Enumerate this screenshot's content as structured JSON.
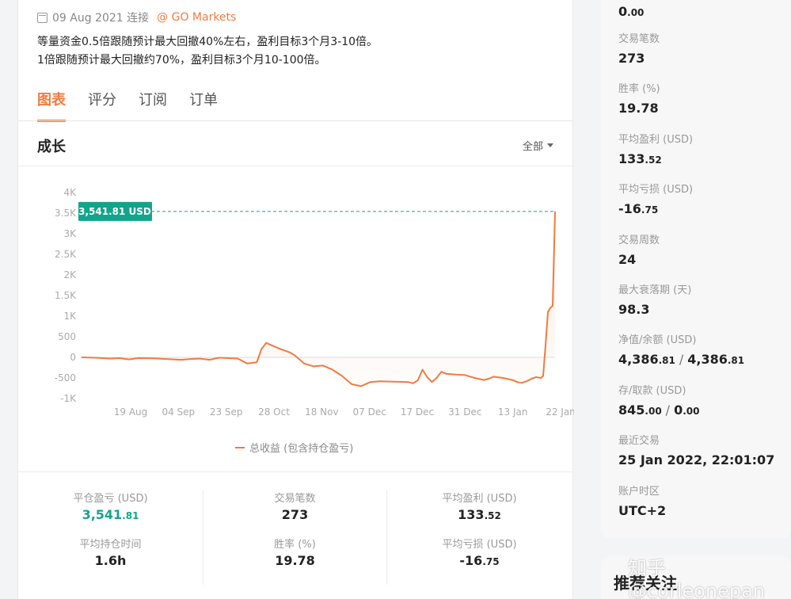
{
  "header": {
    "date": "09 Aug 2021 连接",
    "broker": "@ GO Markets",
    "description_line1": "等量资金0.5倍跟随预计最大回撤40%左右，盈利目标3个月3-10倍。",
    "description_line2": "1倍跟随预计最大回撤约70%，盈利目标3个月10-100倍。"
  },
  "tabs": [
    {
      "label": "图表",
      "active": true
    },
    {
      "label": "评分",
      "active": false
    },
    {
      "label": "订阅",
      "active": false
    },
    {
      "label": "订单",
      "active": false
    }
  ],
  "card": {
    "title": "成长",
    "filter_label": "全部"
  },
  "chart_data": {
    "type": "area",
    "y_ticks": [
      "4K",
      "3.5K",
      "3K",
      "2.5K",
      "2K",
      "1.5K",
      "1K",
      "500",
      "0",
      "-500",
      "-1K"
    ],
    "x_ticks": [
      "19 Aug",
      "04 Sep",
      "23 Sep",
      "28 Oct",
      "18 Nov",
      "07 Dec",
      "17 Dec",
      "31 Dec",
      "13 Jan",
      "22 Jan"
    ],
    "ylim": [
      -1000,
      4000
    ],
    "current_label": "3,541.81 USD",
    "current_value": 3541.81,
    "line_color": "#f07b3f",
    "label_color": "#12a58b",
    "series": [
      {
        "name": "总收益 (包含持仓盈亏)",
        "points": [
          [
            0,
            0
          ],
          [
            0.03,
            -10
          ],
          [
            0.06,
            -30
          ],
          [
            0.08,
            -20
          ],
          [
            0.1,
            -50
          ],
          [
            0.12,
            -20
          ],
          [
            0.15,
            -25
          ],
          [
            0.18,
            -40
          ],
          [
            0.21,
            -60
          ],
          [
            0.23,
            -40
          ],
          [
            0.25,
            -30
          ],
          [
            0.27,
            -60
          ],
          [
            0.29,
            -10
          ],
          [
            0.31,
            -20
          ],
          [
            0.33,
            -30
          ],
          [
            0.35,
            -150
          ],
          [
            0.37,
            -120
          ],
          [
            0.38,
            200
          ],
          [
            0.39,
            350
          ],
          [
            0.4,
            300
          ],
          [
            0.42,
            200
          ],
          [
            0.44,
            120
          ],
          [
            0.45,
            50
          ],
          [
            0.47,
            -150
          ],
          [
            0.49,
            -220
          ],
          [
            0.51,
            -200
          ],
          [
            0.53,
            -300
          ],
          [
            0.55,
            -450
          ],
          [
            0.57,
            -650
          ],
          [
            0.59,
            -700
          ],
          [
            0.6,
            -650
          ],
          [
            0.61,
            -600
          ],
          [
            0.63,
            -580
          ],
          [
            0.66,
            -590
          ],
          [
            0.69,
            -600
          ],
          [
            0.7,
            -630
          ],
          [
            0.71,
            -560
          ],
          [
            0.72,
            -300
          ],
          [
            0.73,
            -480
          ],
          [
            0.74,
            -600
          ],
          [
            0.75,
            -500
          ],
          [
            0.76,
            -350
          ],
          [
            0.77,
            -400
          ],
          [
            0.79,
            -420
          ],
          [
            0.81,
            -430
          ],
          [
            0.83,
            -500
          ],
          [
            0.85,
            -550
          ],
          [
            0.86,
            -520
          ],
          [
            0.87,
            -470
          ],
          [
            0.89,
            -500
          ],
          [
            0.91,
            -550
          ],
          [
            0.92,
            -600
          ],
          [
            0.93,
            -620
          ],
          [
            0.94,
            -580
          ],
          [
            0.95,
            -520
          ],
          [
            0.96,
            -480
          ],
          [
            0.97,
            -500
          ],
          [
            0.975,
            -450
          ],
          [
            0.98,
            300
          ],
          [
            0.985,
            1100
          ],
          [
            0.99,
            1200
          ],
          [
            0.995,
            1250
          ],
          [
            1.0,
            3541.81
          ]
        ]
      }
    ]
  },
  "stats": [
    {
      "label": "平仓盈亏 (USD)",
      "value_int": "3,541",
      "value_dec": ".81",
      "green": true
    },
    {
      "label": "交易笔数",
      "value_int": "273",
      "value_dec": "",
      "green": false
    },
    {
      "label": "平均盈利 (USD)",
      "value_int": "133",
      "value_dec": ".52",
      "green": false
    },
    {
      "label": "平均持仓时间",
      "value_int": "1.6h",
      "value_dec": "",
      "green": false
    },
    {
      "label": "胜率 (%)",
      "value_int": "19.78",
      "value_dec": "",
      "green": false
    },
    {
      "label": "平均亏损 (USD)",
      "value_int": "-16",
      "value_dec": ".75",
      "green": false
    }
  ],
  "sidebar": {
    "top_value_int": "0",
    "top_value_dec": ".00",
    "items": [
      {
        "label": "交易笔数",
        "value": "273"
      },
      {
        "label": "胜率 (%)",
        "value": "19.78"
      },
      {
        "label": "平均盈利 (USD)",
        "value_int": "133",
        "value_dec": ".52"
      },
      {
        "label": "平均亏损 (USD)",
        "value_int": "-16",
        "value_dec": ".75"
      },
      {
        "label": "交易周数",
        "value": "24"
      },
      {
        "label": "最大衰落期 (天)",
        "value": "98.3"
      },
      {
        "label": "净值/余额 (USD)",
        "a_int": "4,386",
        "a_dec": ".81",
        "b_int": "4,386",
        "b_dec": ".81"
      },
      {
        "label": "存/取款 (USD)",
        "a_int": "845",
        "a_dec": ".00",
        "b_int": "0",
        "b_dec": ".00"
      },
      {
        "label": "最近交易",
        "value": "25 Jan 2022, 22:01:07"
      },
      {
        "label": "账户时区",
        "value": "UTC+2"
      }
    ],
    "separator": "/"
  },
  "recommend": {
    "title": "推荐关注"
  },
  "watermark": "知乎 @corleonepan"
}
